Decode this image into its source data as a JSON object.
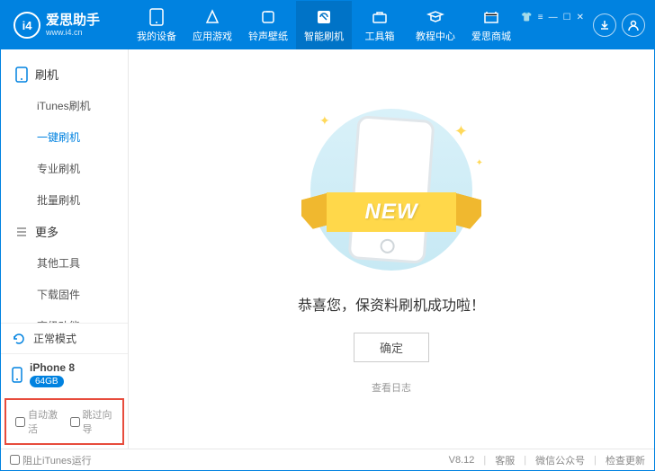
{
  "header": {
    "logo_text": "爱思助手",
    "logo_sub": "www.i4.cn",
    "logo_badge": "i4",
    "nav": [
      {
        "label": "我的设备"
      },
      {
        "label": "应用游戏"
      },
      {
        "label": "铃声壁纸"
      },
      {
        "label": "智能刷机"
      },
      {
        "label": "工具箱"
      },
      {
        "label": "教程中心"
      },
      {
        "label": "爱思商城"
      }
    ],
    "active_nav": 3
  },
  "sidebar": {
    "group1": "刷机",
    "items1": [
      {
        "label": "iTunes刷机"
      },
      {
        "label": "一键刷机"
      },
      {
        "label": "专业刷机"
      },
      {
        "label": "批量刷机"
      }
    ],
    "active1": 1,
    "group2": "更多",
    "items2": [
      {
        "label": "其他工具"
      },
      {
        "label": "下载固件"
      },
      {
        "label": "高级功能"
      }
    ],
    "mode": "正常模式",
    "device": "iPhone 8",
    "storage": "64GB",
    "auto_activate": "自动激活",
    "skip_guide": "跳过向导"
  },
  "main": {
    "ribbon": "NEW",
    "success": "恭喜您，保资料刷机成功啦！",
    "ok": "确定",
    "view_log": "查看日志"
  },
  "footer": {
    "block_itunes": "阻止iTunes运行",
    "version": "V8.12",
    "service": "客服",
    "wechat": "微信公众号",
    "update": "检查更新"
  }
}
